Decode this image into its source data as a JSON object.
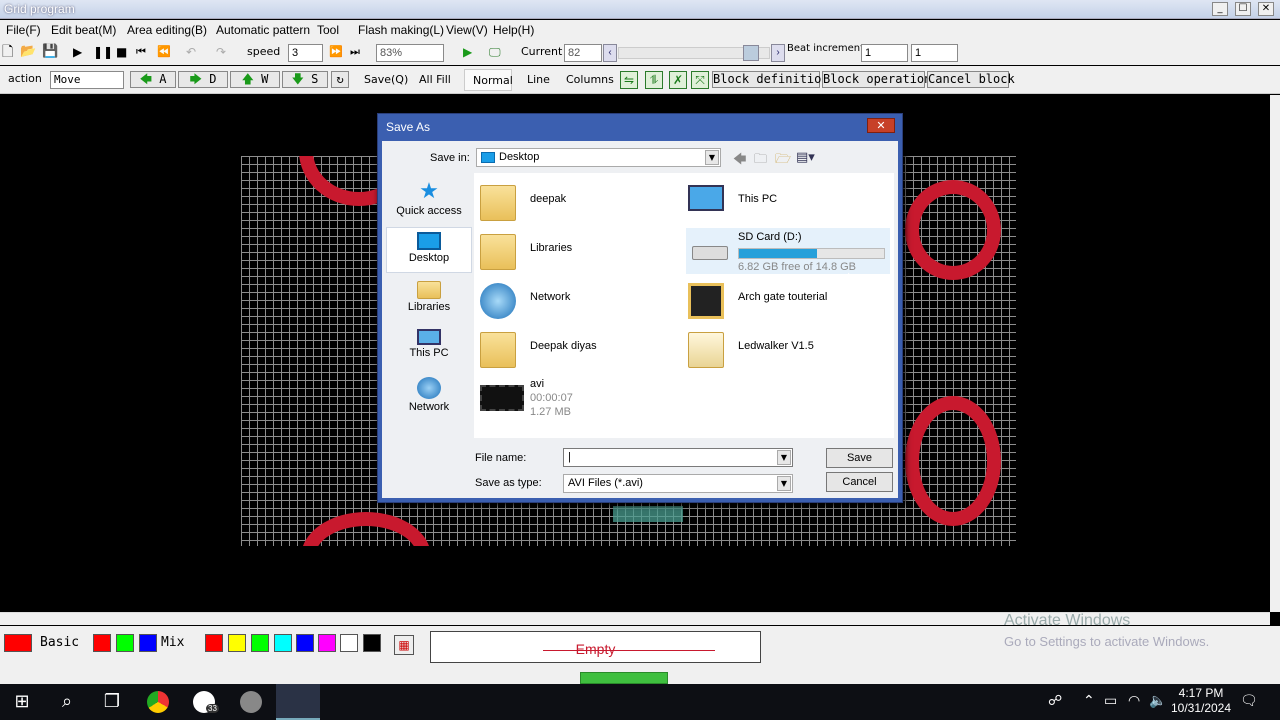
{
  "window": {
    "title": "Grid program",
    "controls": [
      "_",
      "☐",
      "✕"
    ]
  },
  "menu": [
    "File(F)",
    "Edit beat(M)",
    "Area editing(B)",
    "Automatic pattern",
    "Tool",
    "Flash making(L)",
    "View(V)",
    "Help(H)"
  ],
  "toolbar1": {
    "speed_label": "speed",
    "speed_value": "3",
    "zoom_value": "83%",
    "current_label": "Current",
    "current_value": "82",
    "beat_increment_label": "Beat increment",
    "beat_increment_value1": "1",
    "beat_increment_value2": "1"
  },
  "toolbar2": {
    "action_label": "action",
    "action_value": "Move",
    "a_label": "A",
    "d_label": "D",
    "w_label": "W",
    "s_label": "S",
    "save_label": "Save(Q)",
    "all_fill_label": "All Fill",
    "normal_label": "Normal",
    "line_label": "Line",
    "columns_label": "Columns",
    "block_definition_label": "Block definition",
    "block_operation_label": "Block operation",
    "cancel_block_label": "Cancel block"
  },
  "dialog": {
    "title": "Save As",
    "save_in_label": "Save in:",
    "save_in_value": "Desktop",
    "places": [
      "Quick access",
      "Desktop",
      "Libraries",
      "This PC",
      "Network"
    ],
    "items": [
      {
        "name": "deepak",
        "icon": "user-folder-icon"
      },
      {
        "name": "This PC",
        "icon": "pc-icon"
      },
      {
        "name": "Libraries",
        "icon": "libraries-icon"
      },
      {
        "name": "SD Card (D:)",
        "icon": "drive-icon",
        "free_text": "6.82 GB free of 14.8 GB",
        "used_fraction": 0.54
      },
      {
        "name": "Network",
        "icon": "network-icon"
      },
      {
        "name": "Arch gate touterial",
        "icon": "folder-icon"
      },
      {
        "name": "Deepak diyas",
        "icon": "folder-icon"
      },
      {
        "name": "Ledwalker V1.5",
        "icon": "folder-icon"
      },
      {
        "name": "avi",
        "icon": "video-icon",
        "duration": "00:00:07",
        "size": "1.27 MB"
      }
    ],
    "file_name_label": "File name:",
    "file_name_value": "",
    "save_as_type_label": "Save as type:",
    "save_as_type_value": "AVI Files (*.avi)",
    "save_button": "Save",
    "cancel_button": "Cancel"
  },
  "palette": {
    "basic_label": "Basic",
    "mix_label": "Mix",
    "basic_colors": [
      "#ff0000",
      "#00ff00",
      "#0000ff"
    ],
    "mix_colors": [
      "#ff0000",
      "#ffff00",
      "#00ff00",
      "#00ffff",
      "#0000ff",
      "#ff00ff",
      "#ffffff",
      "#000000"
    ],
    "current_color": "#ff0000"
  },
  "status": {
    "empty_label": "Empty"
  },
  "watermark": {
    "line1": "Activate Windows",
    "line2": "Go to Settings to activate Windows."
  },
  "taskbar": {
    "time": "4:17 PM",
    "date": "10/31/2024",
    "badge": "33"
  }
}
